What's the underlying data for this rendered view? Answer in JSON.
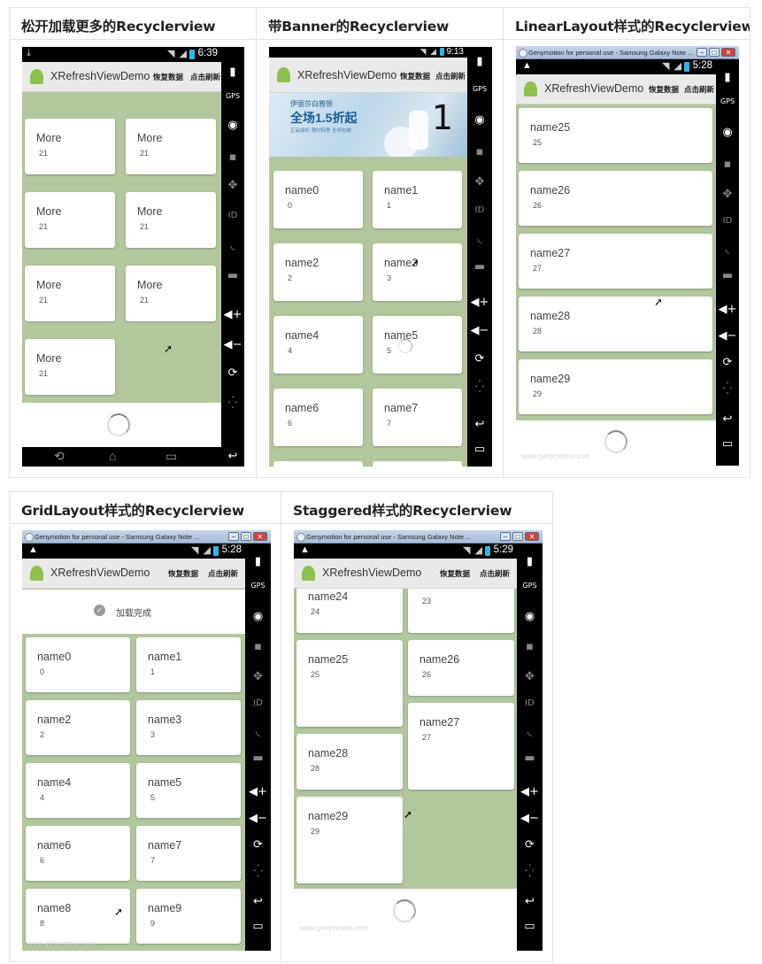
{
  "panels": [
    {
      "heading": "松开加载更多的Recyclerview",
      "status_time": "6:39",
      "app_title": "XRefreshViewDemo",
      "action_restore": "恢复数据",
      "action_refresh": "点击刷新",
      "cards": [
        {
          "title": "More",
          "sub": "21"
        },
        {
          "title": "More",
          "sub": "21"
        },
        {
          "title": "More",
          "sub": "21"
        },
        {
          "title": "More",
          "sub": "21"
        },
        {
          "title": "More",
          "sub": "21"
        },
        {
          "title": "More",
          "sub": "21"
        },
        {
          "title": "More",
          "sub": "21"
        }
      ]
    },
    {
      "heading": "带Banner的Recyclerview",
      "status_time": "9:13",
      "app_title": "XRefreshViewDemo",
      "action_restore": "恢复数据",
      "action_refresh": "点击刷新",
      "banner": {
        "line1": "伊丽莎白雅顿",
        "line2": "全场1.5折起",
        "line3": "正品授权 限时特惠 全场包邮",
        "page_number": "1"
      },
      "cards": [
        {
          "title": "name0",
          "sub": "0"
        },
        {
          "title": "name1",
          "sub": "1"
        },
        {
          "title": "name2",
          "sub": "2"
        },
        {
          "title": "name3",
          "sub": "3"
        },
        {
          "title": "name4",
          "sub": "4"
        },
        {
          "title": "name5",
          "sub": "5"
        },
        {
          "title": "name6",
          "sub": "6"
        },
        {
          "title": "name7",
          "sub": "7"
        }
      ]
    },
    {
      "heading": "LinearLayout样式的Recyclerview",
      "window_title": "Genymotion for personal use - Samsung Galaxy Note ...",
      "status_time": "5:28",
      "app_title": "XRefreshViewDemo",
      "action_restore": "恢复数据",
      "action_refresh": "点击刷新",
      "watermark": "www.genymotion.com",
      "cards": [
        {
          "title": "name25",
          "sub": "25"
        },
        {
          "title": "name26",
          "sub": "26"
        },
        {
          "title": "name27",
          "sub": "27"
        },
        {
          "title": "name28",
          "sub": "28"
        },
        {
          "title": "name29",
          "sub": "29"
        }
      ]
    },
    {
      "heading": "GridLayout样式的Recyclerview",
      "window_title": "Genymotion for personal use - Samsung Galaxy Note ...",
      "status_time": "5:28",
      "app_title": "XRefreshViewDemo",
      "action_restore": "恢复数据",
      "action_refresh": "点击刷新",
      "load_complete": "加载完成",
      "watermark": "www.genymotion.com",
      "cards": [
        {
          "title": "name0",
          "sub": "0"
        },
        {
          "title": "name1",
          "sub": "1"
        },
        {
          "title": "name2",
          "sub": "2"
        },
        {
          "title": "name3",
          "sub": "3"
        },
        {
          "title": "name4",
          "sub": "4"
        },
        {
          "title": "name5",
          "sub": "5"
        },
        {
          "title": "name6",
          "sub": "6"
        },
        {
          "title": "name7",
          "sub": "7"
        },
        {
          "title": "name8",
          "sub": "8"
        },
        {
          "title": "name9",
          "sub": "9"
        }
      ]
    },
    {
      "heading": "Staggered样式的Recyclerview",
      "window_title": "Genymotion for personal use - Samsung Galaxy Note ...",
      "status_time": "5:29",
      "app_title": "XRefreshViewDemo",
      "action_restore": "恢复数据",
      "action_refresh": "点击刷新",
      "watermark": "www.genymotion.com",
      "cards": [
        {
          "title": "",
          "sub": "23"
        },
        {
          "title": "name24",
          "sub": "24"
        },
        {
          "title": "name25",
          "sub": "25"
        },
        {
          "title": "name26",
          "sub": "26"
        },
        {
          "title": "name27",
          "sub": "27"
        },
        {
          "title": "name28",
          "sub": "28"
        },
        {
          "title": "name29",
          "sub": "29"
        }
      ]
    }
  ],
  "colors": {
    "list_background": "#b3c79f",
    "battery": "#33b5e5",
    "android_logo": "#8dc04f"
  },
  "icons": {
    "bezel": [
      "battery-icon",
      "gps-icon",
      "webcam-icon",
      "camera-icon",
      "dpad-icon",
      "id-icon",
      "rss-icon",
      "sms-icon",
      "volume-up-icon",
      "volume-down-icon",
      "rotate-icon",
      "move-icon",
      "back-icon",
      "menu-icon"
    ]
  }
}
